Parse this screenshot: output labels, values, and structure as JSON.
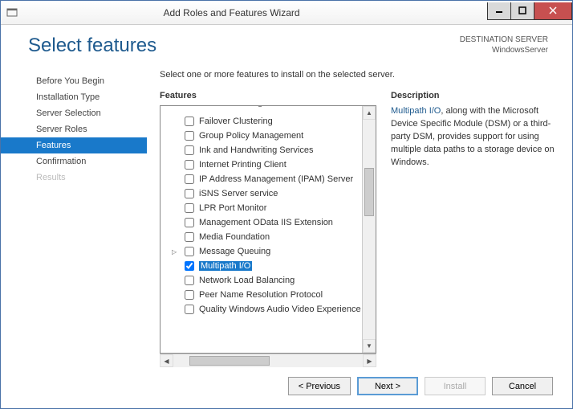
{
  "window": {
    "title": "Add Roles and Features Wizard"
  },
  "header": {
    "title": "Select features",
    "destination_label": "DESTINATION SERVER",
    "destination_value": "WindowsServer"
  },
  "sidebar": {
    "items": [
      {
        "label": "Before You Begin"
      },
      {
        "label": "Installation Type"
      },
      {
        "label": "Server Selection"
      },
      {
        "label": "Server Roles"
      },
      {
        "label": "Features"
      },
      {
        "label": "Confirmation"
      },
      {
        "label": "Results"
      }
    ]
  },
  "main": {
    "instruction": "Select one or more features to install on the selected server.",
    "features_label": "Features",
    "description_label": "Description",
    "features": [
      {
        "label": "Failover Clustering",
        "checked": false,
        "expander": false
      },
      {
        "label": "Group Policy Management",
        "checked": false,
        "expander": false
      },
      {
        "label": "Ink and Handwriting Services",
        "checked": false,
        "expander": false
      },
      {
        "label": "Internet Printing Client",
        "checked": false,
        "expander": false
      },
      {
        "label": "IP Address Management (IPAM) Server",
        "checked": false,
        "expander": false
      },
      {
        "label": "iSNS Server service",
        "checked": false,
        "expander": false
      },
      {
        "label": "LPR Port Monitor",
        "checked": false,
        "expander": false
      },
      {
        "label": "Management OData IIS Extension",
        "checked": false,
        "expander": false
      },
      {
        "label": "Media Foundation",
        "checked": false,
        "expander": false
      },
      {
        "label": "Message Queuing",
        "checked": false,
        "expander": true
      },
      {
        "label": "Multipath I/O",
        "checked": true,
        "expander": false,
        "selected": true
      },
      {
        "label": "Network Load Balancing",
        "checked": false,
        "expander": false
      },
      {
        "label": "Peer Name Resolution Protocol",
        "checked": false,
        "expander": false
      },
      {
        "label": "Quality Windows Audio Video Experience",
        "checked": false,
        "expander": false
      }
    ],
    "description_link": "Multipath I/O",
    "description_rest": ", along with the Microsoft Device Specific Module (DSM) or a third-party DSM, provides support for using multiple data paths to a storage device on Windows."
  },
  "footer": {
    "previous": "< Previous",
    "next": "Next >",
    "install": "Install",
    "cancel": "Cancel"
  }
}
